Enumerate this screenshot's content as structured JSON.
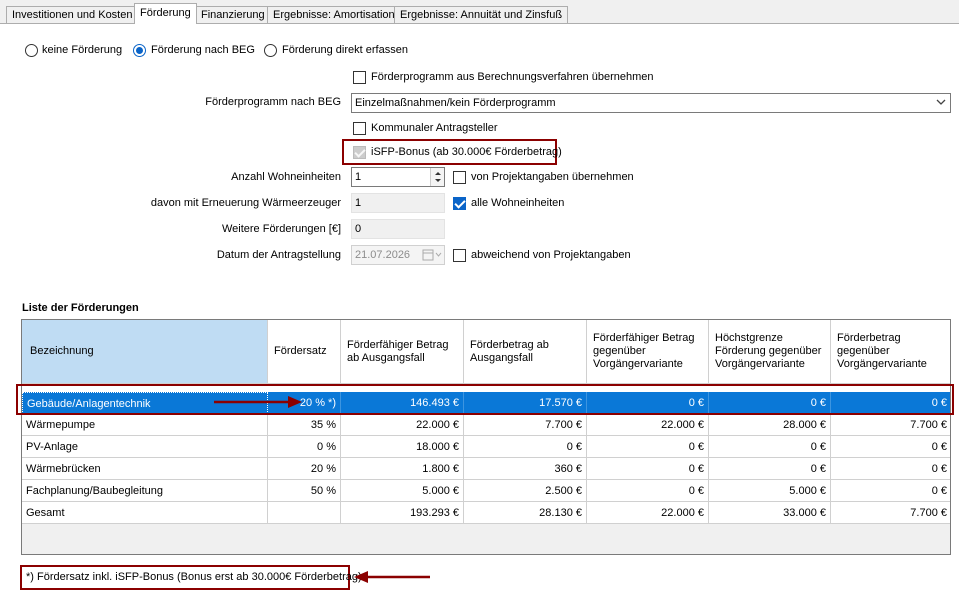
{
  "tabs": [
    {
      "label": "Investitionen und Kosten",
      "active": false
    },
    {
      "label": "Förderung",
      "active": true
    },
    {
      "label": "Finanzierung",
      "active": false
    },
    {
      "label": "Ergebnisse: Amortisation",
      "active": false
    },
    {
      "label": "Ergebnisse: Annuität und Zinsfuß",
      "active": false
    }
  ],
  "funding_mode": {
    "options": [
      "keine Förderung",
      "Förderung nach BEG",
      "Förderung direkt erfassen"
    ],
    "selected": "Förderung nach BEG"
  },
  "form": {
    "take_program_label": "Förderprogramm aus Berechnungsverfahren übernehmen",
    "program_label": "Förderprogramm nach BEG",
    "program_value": "Einzelmaßnahmen/kein Förderprogramm",
    "municipal_label": "Kommunaler Antragsteller",
    "isfp_label": "iSFP-Bonus (ab 30.000€ Förderbetrag)",
    "units_label": "Anzahl Wohneinheiten",
    "units_value": "1",
    "units_from_project_label": "von Projektangaben übernehmen",
    "heat_units_label": "davon mit Erneuerung Wärmeerzeuger",
    "heat_units_value": "1",
    "all_units_label": "alle Wohneinheiten",
    "other_funding_label": "Weitere Förderungen [€]",
    "other_funding_value": "0",
    "date_label": "Datum der Antragstellung",
    "date_value": "21.07.2026",
    "date_deviating_label": "abweichend von Projektangaben"
  },
  "list_title": "Liste der Förderungen",
  "table": {
    "headers": [
      "Bezeichnung",
      "Fördersatz",
      "Förderfähiger Betrag ab Ausgangsfall",
      "Förderbetrag ab Ausgangsfall",
      "Förderfähiger Betrag gegenüber Vorgängervariante",
      "Höchstgrenze Förderung gegenüber Vorgängervariante",
      "Förderbetrag gegenüber Vorgängervariante"
    ],
    "rows": [
      [
        "Gebäude/Anlagentechnik",
        "20 % *)",
        "146.493 €",
        "17.570 €",
        "0 €",
        "0 €",
        "0 €"
      ],
      [
        "Wärmepumpe",
        "35 %",
        "22.000 €",
        "7.700 €",
        "22.000 €",
        "28.000 €",
        "7.700 €"
      ],
      [
        "PV-Anlage",
        "0 %",
        "18.000 €",
        "0 €",
        "0 €",
        "0 €",
        "0 €"
      ],
      [
        "Wärmebrücken",
        "20 %",
        "1.800 €",
        "360 €",
        "0 €",
        "0 €",
        "0 €"
      ],
      [
        "Fachplanung/Baubegleitung",
        "50 %",
        "5.000 €",
        "2.500 €",
        "0 €",
        "5.000 €",
        "0 €"
      ],
      [
        "Gesamt",
        "",
        "193.293 €",
        "28.130 €",
        "22.000 €",
        "33.000 €",
        "7.700 €"
      ]
    ]
  },
  "footnote": "*) Fördersatz inkl. iSFP-Bonus (Bonus erst ab 30.000€ Förderbetrag)",
  "colors": {
    "selection": "#0a78d7",
    "header_highlight": "#bfdcf3",
    "annotation_red": "#8b0000"
  }
}
